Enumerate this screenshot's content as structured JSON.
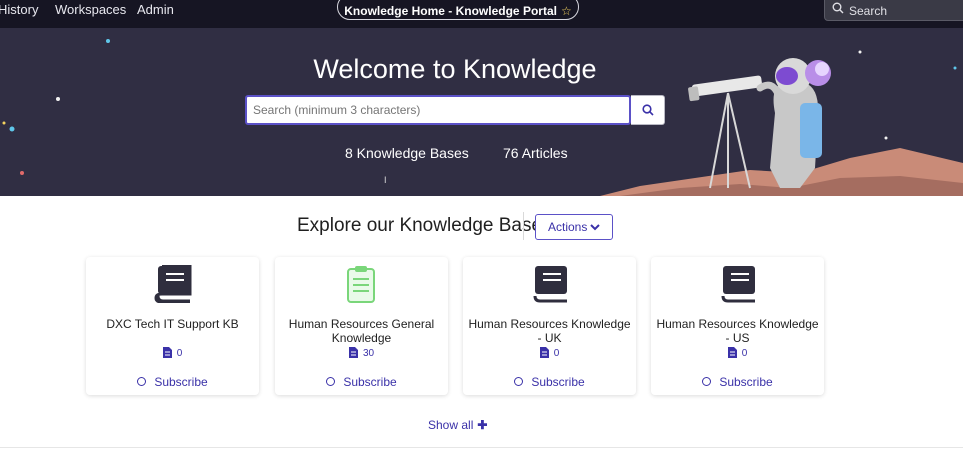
{
  "nav": {
    "links": [
      "History",
      "Workspaces",
      "Admin"
    ],
    "page_title": "Knowledge Home - Knowledge Portal",
    "search_label": "Search"
  },
  "hero": {
    "title": "Welcome to Knowledge",
    "search_placeholder": "Search (minimum 3 characters)",
    "stats": {
      "bases": "8 Knowledge Bases",
      "articles": "76 Articles"
    }
  },
  "explore": {
    "title": "Explore our Knowledge Bases",
    "actions_label": "Actions"
  },
  "cards": [
    {
      "title": "DXC Tech IT Support KB",
      "count": "0",
      "subscribe": "Subscribe",
      "icon": "book-icon",
      "icon_color": "#2f2e3e"
    },
    {
      "title": "Human Resources General Knowledge",
      "count": "30",
      "subscribe": "Subscribe",
      "icon": "clipboard-icon",
      "icon_color": "#7ad67a"
    },
    {
      "title": "Human Resources Knowledge - UK",
      "count": "0",
      "subscribe": "Subscribe",
      "icon": "book-icon",
      "icon_color": "#2f2e3e"
    },
    {
      "title": "Human Resources Knowledge - US",
      "count": "0",
      "subscribe": "Subscribe",
      "icon": "book-icon",
      "icon_color": "#2f2e3e"
    }
  ],
  "show_all_label": "Show all",
  "colors": {
    "nav_bg": "#161523",
    "hero_bg": "#302e43",
    "accent": "#3a31a8"
  }
}
